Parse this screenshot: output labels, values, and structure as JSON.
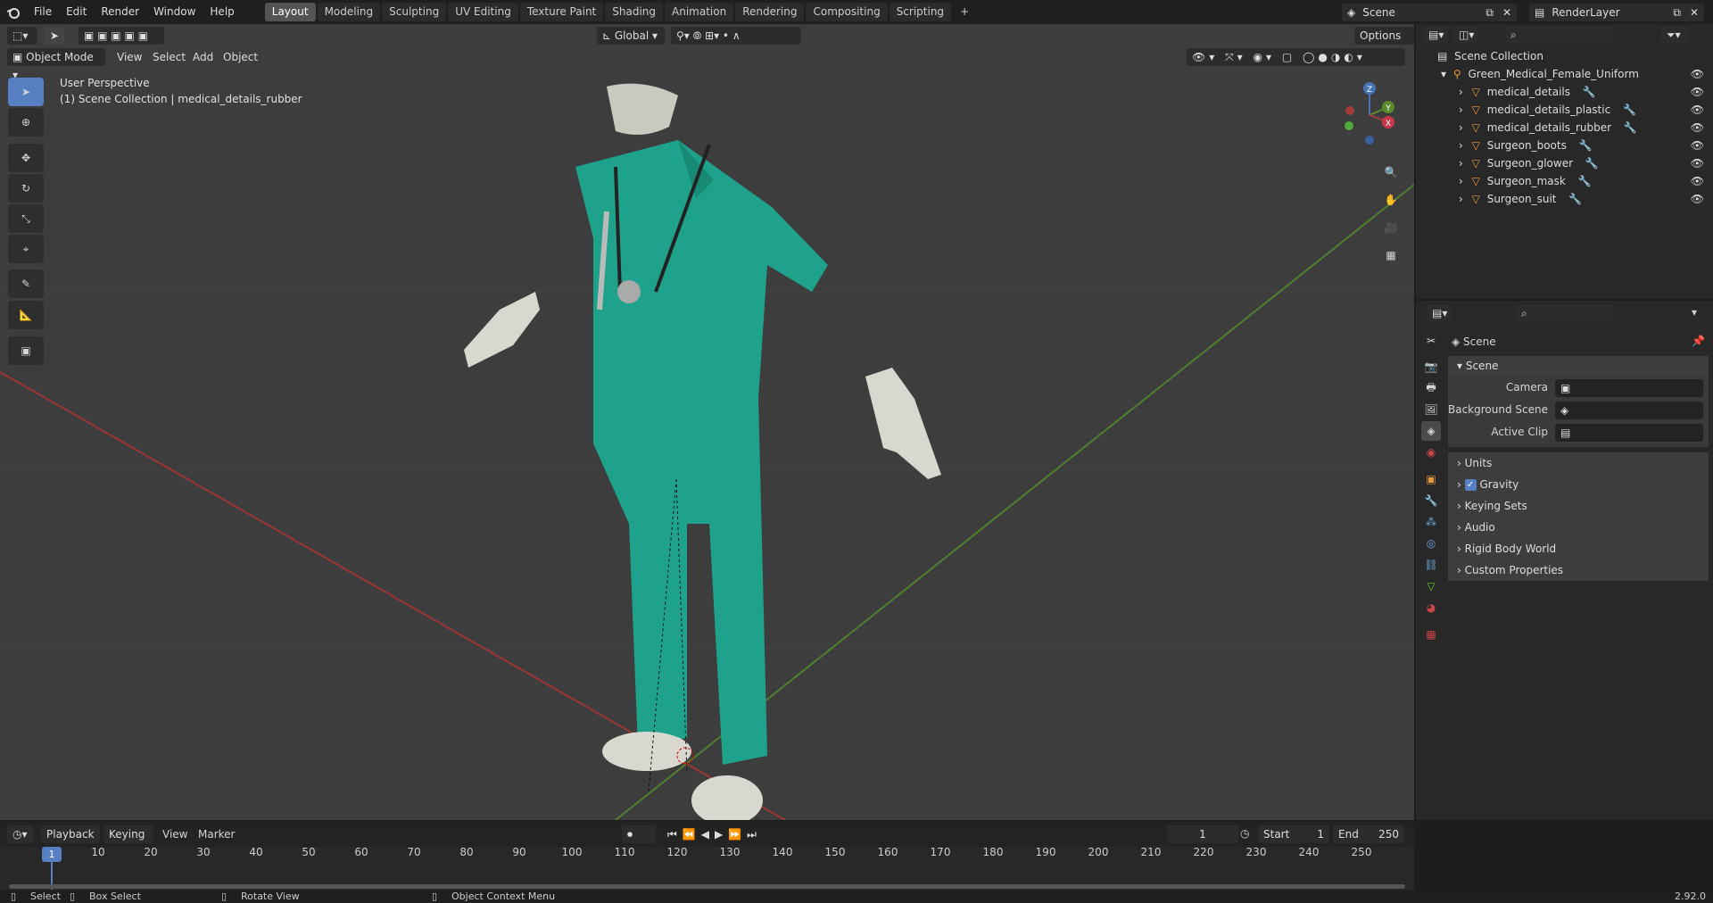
{
  "topbar": {
    "menus": [
      "File",
      "Edit",
      "Render",
      "Window",
      "Help"
    ],
    "workspaces": [
      "Layout",
      "Modeling",
      "Sculpting",
      "UV Editing",
      "Texture Paint",
      "Shading",
      "Animation",
      "Rendering",
      "Compositing",
      "Scripting"
    ],
    "active_workspace": "Layout",
    "scene": "Scene",
    "render_layer": "RenderLayer"
  },
  "viewport": {
    "mode": "Object Mode",
    "menus": [
      "View",
      "Select",
      "Add",
      "Object"
    ],
    "orientation": "Global",
    "options": "Options",
    "info_line1": "User Perspective",
    "info_line2": "(1) Scene Collection | medical_details_rubber",
    "gizmo": {
      "z": "Z",
      "y": "Y",
      "x": "X"
    }
  },
  "outliner": {
    "root": "Scene Collection",
    "collection": "Green_Medical_Female_Uniform",
    "items": [
      "medical_details",
      "medical_details_plastic",
      "medical_details_rubber",
      "Surgeon_boots",
      "Surgeon_glower",
      "Surgeon_mask",
      "Surgeon_suit"
    ]
  },
  "properties": {
    "context": "Scene",
    "panel": "Scene",
    "camera_label": "Camera",
    "background_scene_label": "Background Scene",
    "active_clip_label": "Active Clip",
    "subpanels": [
      "Units",
      "Gravity",
      "Keying Sets",
      "Audio",
      "Rigid Body World",
      "Custom Properties"
    ],
    "gravity_checked": true
  },
  "timeline": {
    "menus": [
      "Playback",
      "Keying",
      "View",
      "Marker"
    ],
    "current_frame": "1",
    "start_label": "Start",
    "start": "1",
    "end_label": "End",
    "end": "250",
    "ticks": [
      "1",
      "10",
      "20",
      "30",
      "40",
      "50",
      "60",
      "70",
      "80",
      "90",
      "100",
      "110",
      "120",
      "130",
      "140",
      "150",
      "160",
      "170",
      "180",
      "190",
      "200",
      "210",
      "220",
      "230",
      "240",
      "250"
    ]
  },
  "statusbar": {
    "select": "Select",
    "box_select": "Box Select",
    "rotate_view": "Rotate View",
    "context_menu": "Object Context Menu",
    "version": "2.92.0"
  },
  "colors": {
    "accent": "#4772b3",
    "scrubs": "#1fa28c",
    "x_axis": "#a33b3b",
    "y_axis": "#5a8a2a"
  }
}
